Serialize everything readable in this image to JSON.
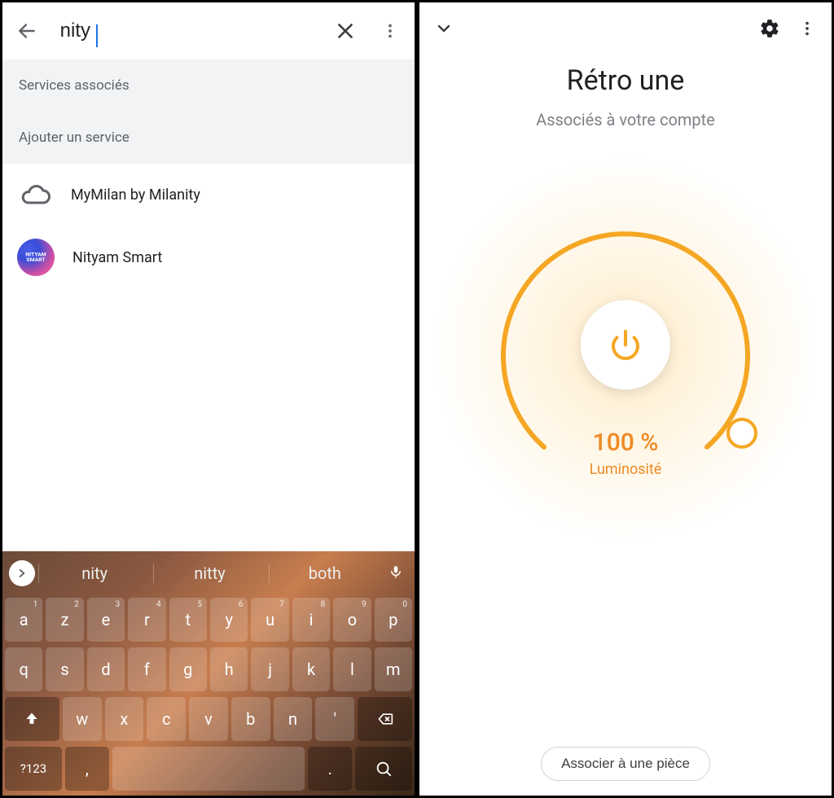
{
  "left": {
    "search_value": "nity",
    "section_associated": "Services associés",
    "section_add": "Ajouter un service",
    "services": [
      {
        "name": "MyMilan by Milanity"
      },
      {
        "name": "Nityam Smart"
      }
    ],
    "nityam_logo_text": "NITYAM SMART",
    "keyboard": {
      "suggestions": [
        "nity",
        "nitty",
        "both"
      ],
      "row1": [
        {
          "k": "a",
          "n": "1"
        },
        {
          "k": "z",
          "n": "2"
        },
        {
          "k": "e",
          "n": "3"
        },
        {
          "k": "r",
          "n": "4"
        },
        {
          "k": "t",
          "n": "5"
        },
        {
          "k": "y",
          "n": "6"
        },
        {
          "k": "u",
          "n": "7"
        },
        {
          "k": "i",
          "n": "8"
        },
        {
          "k": "o",
          "n": "9"
        },
        {
          "k": "p",
          "n": "0"
        }
      ],
      "row2": [
        {
          "k": "q"
        },
        {
          "k": "s"
        },
        {
          "k": "d"
        },
        {
          "k": "f"
        },
        {
          "k": "g"
        },
        {
          "k": "h"
        },
        {
          "k": "j"
        },
        {
          "k": "k"
        },
        {
          "k": "l"
        },
        {
          "k": "m"
        }
      ],
      "row3": [
        {
          "k": "w"
        },
        {
          "k": "x"
        },
        {
          "k": "c"
        },
        {
          "k": "v"
        },
        {
          "k": "b"
        },
        {
          "k": "n"
        },
        {
          "k": "'"
        }
      ],
      "sym_label": "?123",
      "comma": ",",
      "period": "."
    }
  },
  "right": {
    "title": "Rétro une",
    "subtitle": "Associés à votre compte",
    "percentage": "100 %",
    "brightness_label": "Luminosité",
    "associate_button": "Associer à une pièce",
    "accent_color": "#f5a623"
  }
}
